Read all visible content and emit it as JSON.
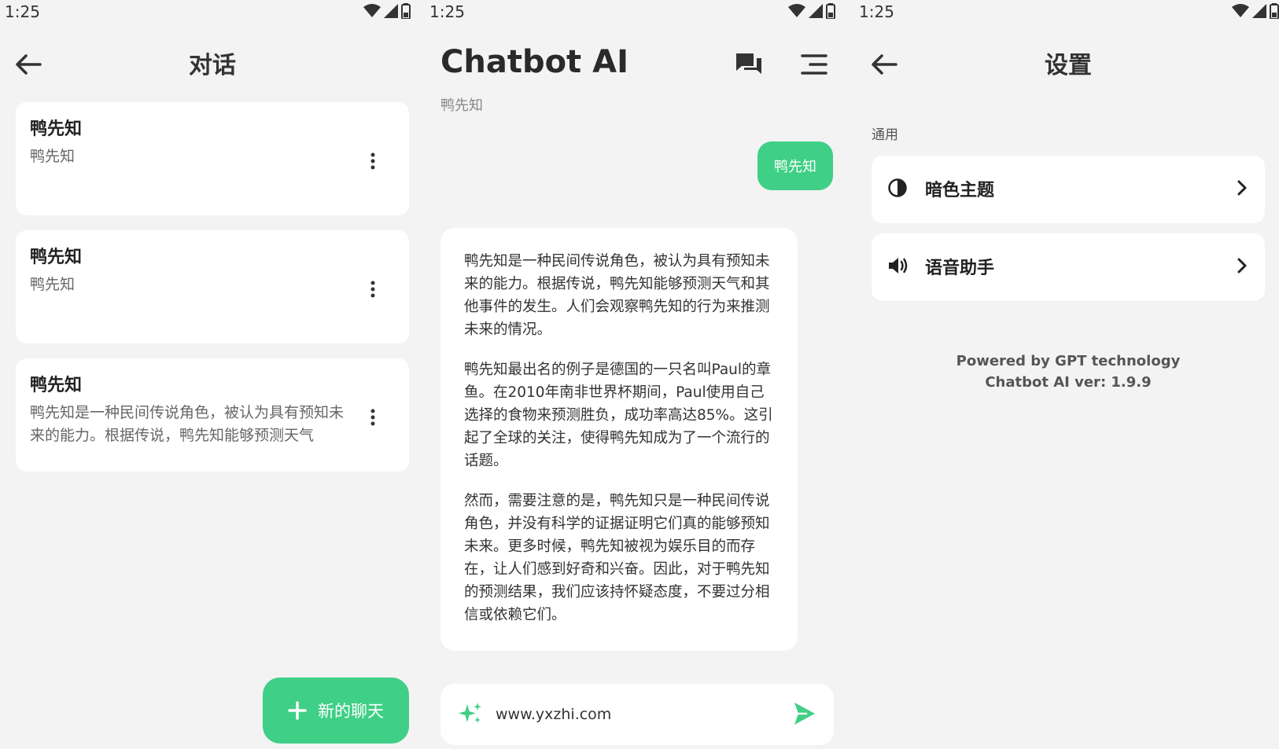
{
  "status_bar": {
    "time": "1:25"
  },
  "conversations": {
    "title": "对话",
    "items": [
      {
        "title": "鸭先知",
        "preview": "鸭先知"
      },
      {
        "title": "鸭先知",
        "preview": "鸭先知"
      },
      {
        "title": "鸭先知",
        "preview": "鸭先知是一种民间传说角色，被认为具有预知未来的能力。根据传说，鸭先知能够预测天气"
      }
    ],
    "new_chat_label": "新的聊天"
  },
  "chat": {
    "app_title": "Chatbot AI",
    "subtitle": "鸭先知",
    "user_message": "鸭先知",
    "bot_paragraphs": [
      "鸭先知是一种民间传说角色，被认为具有预知未来的能力。根据传说，鸭先知能够预测天气和其他事件的发生。人们会观察鸭先知的行为来推测未来的情况。",
      "鸭先知最出名的例子是德国的一只名叫Paul的章鱼。在2010年南非世界杯期间，Paul使用自己选择的食物来预测胜负，成功率高达85%。这引起了全球的关注，使得鸭先知成为了一个流行的话题。",
      "然而，需要注意的是，鸭先知只是一种民间传说角色，并没有科学的证据证明它们真的能够预知未来。更多时候，鸭先知被视为娱乐目的而存在，让人们感到好奇和兴奋。因此，对于鸭先知的预测结果，我们应该持怀疑态度，不要过分相信或依赖它们。"
    ],
    "input_value": "www.yxzhi.com"
  },
  "settings": {
    "title": "设置",
    "section_label": "通用",
    "items": [
      {
        "label": "暗色主题",
        "icon": "contrast-icon"
      },
      {
        "label": "语音助手",
        "icon": "speaker-icon"
      }
    ],
    "footer_line1": "Powered by GPT technology",
    "footer_line2": "Chatbot AI ver: 1.9.9"
  },
  "colors": {
    "accent": "#3fcf86",
    "background": "#f3f3f3",
    "card": "#ffffff"
  }
}
